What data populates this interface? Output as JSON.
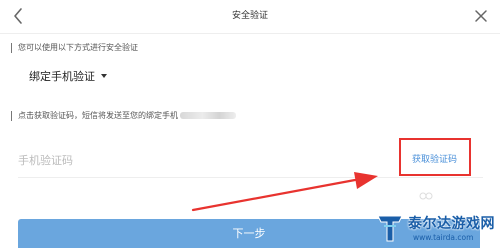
{
  "header": {
    "title": "安全验证",
    "back_icon": "chevron-left-icon",
    "close_icon": "close-icon"
  },
  "verify_method": {
    "hint": "您可以使用以下方式进行安全验证",
    "selected": "绑定手机验证"
  },
  "sms": {
    "hint": "点击获取验证码，短信将发送至您的绑定手机",
    "code_placeholder": "手机验证码",
    "get_code_label": "获取验证码"
  },
  "next_button": {
    "label": "下一步"
  },
  "watermark": {
    "name": "泰尔达游戏网",
    "url": "www.tairda.com"
  },
  "colors": {
    "accent_blue": "#4a90d9",
    "button_blue": "#6aa6de",
    "annotation_red": "#e8332f",
    "watermark_blue": "#1a5ea8"
  }
}
